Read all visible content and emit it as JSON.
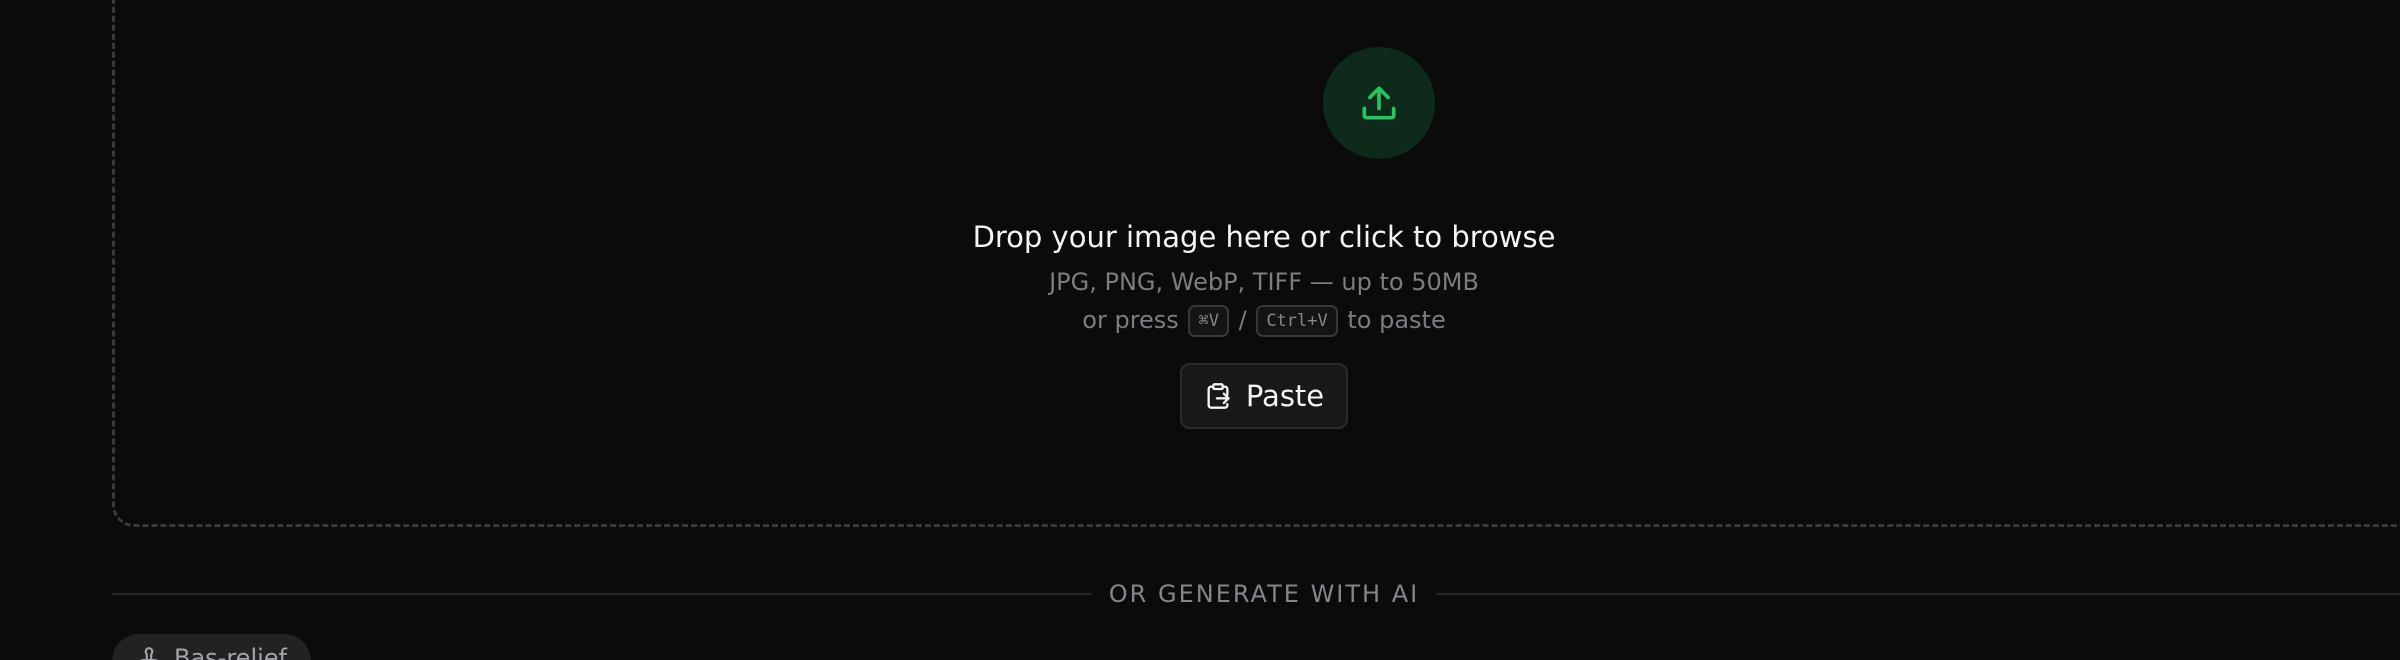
{
  "dropzone": {
    "title": "Drop your image here or click to browse",
    "formats": "JPG, PNG, WebP, TIFF — up to 50MB",
    "paste_hint_prefix": "or press",
    "mac_shortcut": "⌘V",
    "separator": "/",
    "win_shortcut": "Ctrl+V",
    "paste_hint_suffix": "to paste",
    "upload_icon": "upload-icon",
    "accent_color": "#22c55e"
  },
  "paste_button": {
    "label": "Paste",
    "icon": "clipboard-paste-icon"
  },
  "divider": {
    "label": "OR GENERATE WITH AI"
  },
  "presets": [
    {
      "label": "Bas-relief",
      "icon": "stamp-icon"
    }
  ]
}
